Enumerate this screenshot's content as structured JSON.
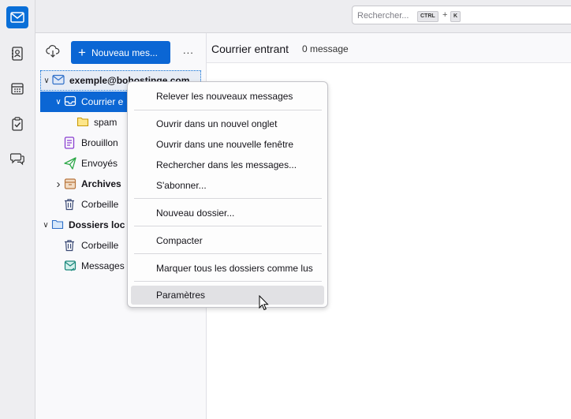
{
  "search": {
    "placeholder": "Rechercher...",
    "key1": "CTRL",
    "plus": "+",
    "key2": "K"
  },
  "toolbar": {
    "new_message": "Nouveau mes...",
    "more": "..."
  },
  "folders": [
    {
      "label": "exemple@bohostinge.com",
      "kind": "account",
      "twisty": "open"
    },
    {
      "label": "Courrier e",
      "kind": "inbox",
      "twisty": "open"
    },
    {
      "label": "spam",
      "kind": "folder",
      "twisty": ""
    },
    {
      "label": "Brouillon",
      "kind": "drafts",
      "twisty": ""
    },
    {
      "label": "Envoyés",
      "kind": "sent",
      "twisty": ""
    },
    {
      "label": "Archives",
      "kind": "archives",
      "twisty": "closed"
    },
    {
      "label": "Corbeille",
      "kind": "trash",
      "twisty": ""
    },
    {
      "label": "Dossiers loc",
      "kind": "local",
      "twisty": "open"
    },
    {
      "label": "Corbeille",
      "kind": "trash",
      "twisty": ""
    },
    {
      "label": "Messages",
      "kind": "outbox",
      "twisty": ""
    }
  ],
  "list_header": {
    "title": "Courrier entrant",
    "count": "0 message"
  },
  "context_menu": {
    "items": [
      "Relever les nouveaux messages",
      "Ouvrir dans un nouvel onglet",
      "Ouvrir dans une nouvelle fenêtre",
      "Rechercher dans les messages...",
      "S'abonner...",
      "Nouveau dossier...",
      "Compacter",
      "Marquer tous les dossiers comme lus",
      "Paramètres"
    ],
    "hovered": "Paramètres"
  },
  "colors": {
    "accent": "#0b66d4",
    "menu_hover": "#e1e1e4"
  }
}
